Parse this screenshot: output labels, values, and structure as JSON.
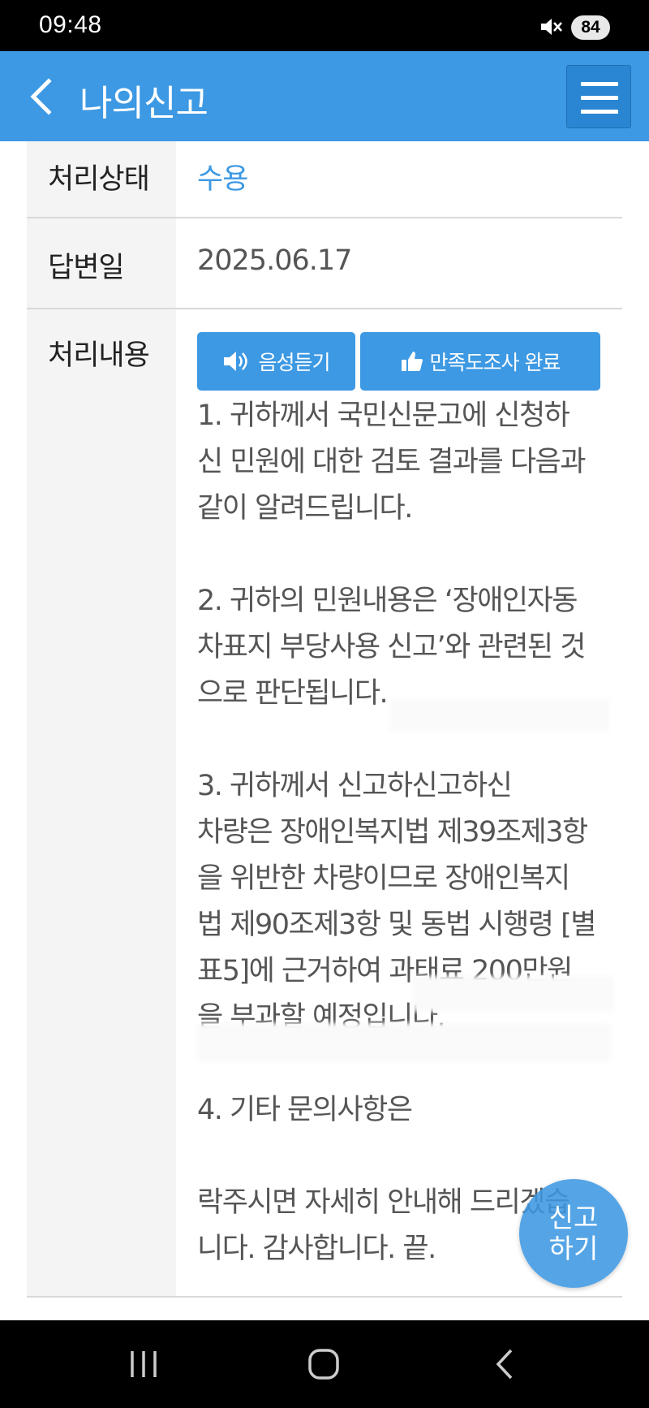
{
  "status_bar": {
    "time": "09:48",
    "battery": "84",
    "icons": [
      "mute-icon",
      "battery-icon"
    ]
  },
  "header": {
    "title": "나의신고",
    "back_icon": "chevron-left-icon",
    "menu_icon": "hamburger-menu-icon"
  },
  "rows": {
    "status": {
      "label": "처리상태",
      "value": "수용"
    },
    "answer_date": {
      "label": "답변일",
      "value": "2025.06.17"
    },
    "content": {
      "label": "처리내용",
      "listen_button": "음성듣기",
      "survey_button": "만족도조사 완료",
      "text": "1. 귀하께서 국민신문고에 신청하\n신 민원에 대한 검토 결과를 다음과\n같이 알려드립니다.\n\n2. 귀하의 민원내용은 ‘장애인자동\n차표지 부당사용 신고’와 관련된 것\n으로 판단됩니다.\n\n3. 귀하께서 신고하신고하신\n차량은 장애인복지법 제39조제3항\n을 위반한 차량이므로 장애인복지\n법 제90조제3항 및 동법 시행령 [별\n표5]에 근거하여 과태료 200만원\n을 부과할 예정입니다.\n\n4. 기타 문의사항은\n\n락주시면 자세히 안내해 드리겠습\n니다. 감사합니다. 끝."
    }
  },
  "fab": {
    "label_line1": "신고",
    "label_line2": "하기"
  },
  "colors": {
    "primary": "#3d99e3",
    "status_value": "#3d99e3"
  }
}
